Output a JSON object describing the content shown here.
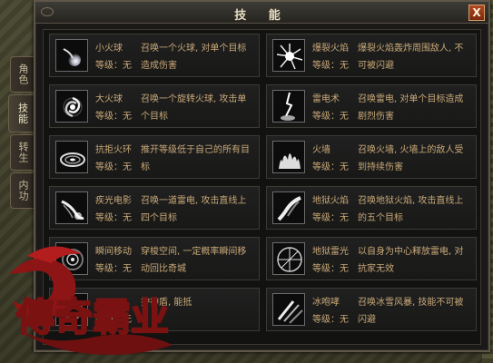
{
  "window": {
    "title": "技 能",
    "close_label": "X"
  },
  "side_tabs": [
    {
      "label": "角色",
      "active": false
    },
    {
      "label": "技能",
      "active": true
    },
    {
      "label": "转生",
      "active": false
    },
    {
      "label": "内功",
      "active": false
    }
  ],
  "level_prefix": "等级：",
  "skills_left": [
    {
      "name": "小火球",
      "level": "无",
      "desc": "召唤一个火球, 对单个目标造成伤害",
      "icon": "small-fireball-icon"
    },
    {
      "name": "大火球",
      "level": "无",
      "desc": "召唤一个旋转火球, 攻击单个目标",
      "icon": "big-fireball-icon"
    },
    {
      "name": "抗拒火环",
      "level": "无",
      "desc": "推开等级低于自己的所有目标",
      "icon": "repel-fire-ring-icon"
    },
    {
      "name": "疾光电影",
      "level": "无",
      "desc": "召唤一道雷电, 攻击直线上四个目标",
      "icon": "lightning-beam-icon"
    },
    {
      "name": "瞬间移动",
      "level": "无",
      "desc": "穿梭空间, 一定概率瞬间移动回比奇城",
      "icon": "teleport-icon"
    },
    {
      "name": "",
      "level": "无",
      "desc": "护神盾, 能抵",
      "icon": "magic-shield-icon"
    }
  ],
  "skills_right": [
    {
      "name": "爆裂火焰",
      "level": "无",
      "desc": "爆裂火焰轰炸周围敌人, 不可被闪避",
      "icon": "fire-burst-icon"
    },
    {
      "name": "雷电术",
      "level": "无",
      "desc": "召唤雷电, 对单个目标造成剧烈伤害",
      "icon": "thunder-icon"
    },
    {
      "name": "火墙",
      "level": "无",
      "desc": "召唤火墙, 火墙上的敌人受到持续伤害",
      "icon": "fire-wall-icon"
    },
    {
      "name": "地狱火焰",
      "level": "无",
      "desc": "召唤地狱火焰, 攻击直线上的五个目标",
      "icon": "hell-fire-icon"
    },
    {
      "name": "地狱雷光",
      "level": "无",
      "desc": "以自身为中心释放雷电, 对抗家无效",
      "icon": "hell-thunder-icon"
    },
    {
      "name": "冰咆哮",
      "level": "无",
      "desc": "召唤冰雪风暴, 技能不可被闪避",
      "icon": "ice-roar-icon"
    }
  ],
  "logo_text": "傳奇霸业"
}
